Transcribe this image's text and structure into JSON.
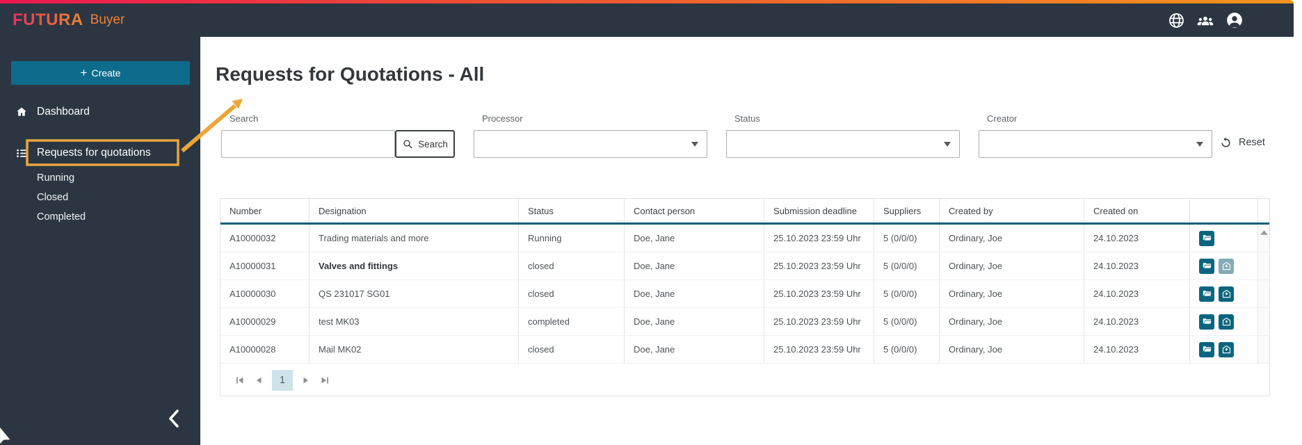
{
  "brand": {
    "name": "FUTURA",
    "product": "Buyer"
  },
  "topbar": {
    "icons": [
      {
        "name": "globe-icon"
      },
      {
        "name": "groups-icon"
      },
      {
        "name": "account-icon"
      }
    ]
  },
  "sidebar": {
    "create_button_label": "Create",
    "items": [
      {
        "label": "Dashboard",
        "icon": "home-icon",
        "highlighted": false
      },
      {
        "label": "Requests for quotations",
        "icon": "list-icon",
        "highlighted": true
      }
    ],
    "sub_items": [
      {
        "label": "Running"
      },
      {
        "label": "Closed"
      },
      {
        "label": "Completed"
      }
    ]
  },
  "page": {
    "title": "Requests for Quotations - All"
  },
  "filters": {
    "search": {
      "label": "Search",
      "value": "",
      "button_label": "Search"
    },
    "processor": {
      "label": "Processor",
      "value": ""
    },
    "status": {
      "label": "Status",
      "value": ""
    },
    "creator": {
      "label": "Creator",
      "value": ""
    },
    "reset_label": "Reset"
  },
  "table": {
    "columns": [
      {
        "label": "Number"
      },
      {
        "label": "Designation"
      },
      {
        "label": "Status"
      },
      {
        "label": "Contact person"
      },
      {
        "label": "Submission deadline"
      },
      {
        "label": "Suppliers"
      },
      {
        "label": "Created by"
      },
      {
        "label": "Created on"
      },
      {
        "label": ""
      }
    ],
    "rows": [
      {
        "number": "A10000032",
        "designation": "Trading materials and more",
        "status": "Running",
        "contact_person": "Doe, Jane",
        "submission_deadline": "25.10.2023 23:59 Uhr",
        "suppliers": "5 (0/0/0)",
        "created_by": "Ordinary, Joe",
        "created_on": "24.10.2023",
        "actions": [
          "open-folder-icon"
        ]
      },
      {
        "number": "A10000031",
        "designation": "Valves and fittings",
        "status": "closed",
        "contact_person": "Doe, Jane",
        "submission_deadline": "25.10.2023 23:59 Uhr",
        "suppliers": "5 (0/0/0)",
        "created_by": "Ordinary, Joe",
        "created_on": "24.10.2023",
        "actions": [
          "open-folder-icon",
          "open-envelope-icon-light"
        ]
      },
      {
        "number": "A10000030",
        "designation": "QS 231017 SG01",
        "status": "closed",
        "contact_person": "Doe, Jane",
        "submission_deadline": "25.10.2023 23:59 Uhr",
        "suppliers": "5 (0/0/0)",
        "created_by": "Ordinary, Joe",
        "created_on": "24.10.2023",
        "actions": [
          "open-folder-icon",
          "open-envelope-icon"
        ]
      },
      {
        "number": "A10000029",
        "designation": "test MK03",
        "status": "completed",
        "contact_person": "Doe, Jane",
        "submission_deadline": "25.10.2023 23:59 Uhr",
        "suppliers": "5 (0/0/0)",
        "created_by": "Ordinary, Joe",
        "created_on": "24.10.2023",
        "actions": [
          "open-folder-icon",
          "open-envelope-icon"
        ]
      },
      {
        "number": "A10000028",
        "designation": "Mail MK02",
        "status": "closed",
        "contact_person": "Doe, Jane",
        "submission_deadline": "25.10.2023 23:59 Uhr",
        "suppliers": "5 (0/0/0)",
        "created_by": "Ordinary, Joe",
        "created_on": "24.10.2023",
        "actions": [
          "open-folder-icon",
          "open-envelope-icon"
        ]
      }
    ]
  },
  "pagination": {
    "current_page": "1"
  },
  "colors": {
    "dark_navy": "#2b3642",
    "accent_teal": "#0d6c8c",
    "header_underline_teal": "#0a5f78",
    "icon_teal": "#0b657f",
    "icon_teal_light": "#85abb9",
    "annotation_orange": "#eaa53c",
    "gradient_left": "#ec1651",
    "gradient_right": "#f5941e",
    "pagination_active_bg": "#cfe2e9"
  }
}
